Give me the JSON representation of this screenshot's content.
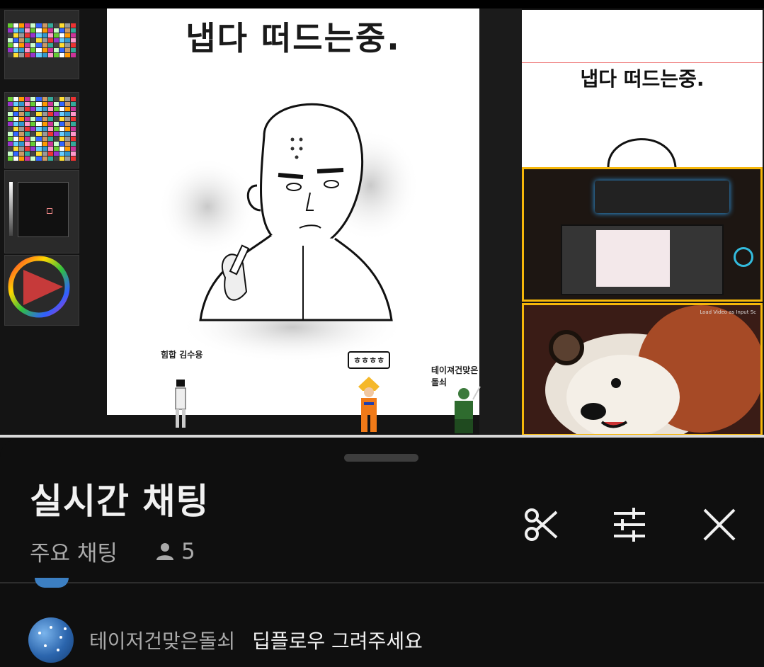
{
  "stream": {
    "canvas_title": "냅다 떠드는중.",
    "reference_title": "냅다 떠드는중.",
    "caption_left": "힘합 김수용",
    "caption_center": "ㅎㅎㅎㅎ",
    "caption_right": "테이져건맞은돌쇠"
  },
  "chat_panel": {
    "title": "실시간 채팅",
    "mode_label": "주요 채팅",
    "viewer_count": "5",
    "clip_icon": "scissors-icon",
    "filter_icon": "sliders-icon",
    "close_icon": "close-icon"
  },
  "messages": [
    {
      "author": "테이저건맞은돌쇠",
      "text": "딥플로우 그려주세요"
    }
  ],
  "colors": {
    "accent_frame": "#f6b70a",
    "background": "#0f0f0f",
    "text_primary": "#f1f1f1",
    "text_secondary": "#aaaaaa"
  }
}
